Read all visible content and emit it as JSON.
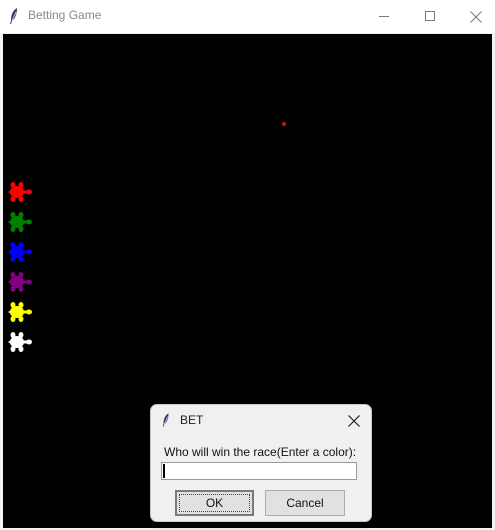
{
  "window": {
    "title": "Betting Game",
    "icon": "feather-icon",
    "controls": [
      "minimize-icon",
      "maximize-icon",
      "close-icon"
    ]
  },
  "canvas": {
    "background": "#000000",
    "turtles": [
      {
        "color": "red"
      },
      {
        "color": "green"
      },
      {
        "color": "blue"
      },
      {
        "color": "purple"
      },
      {
        "color": "yellow"
      },
      {
        "color": "white"
      }
    ]
  },
  "dialog": {
    "title": "BET",
    "icon": "feather-icon",
    "prompt": "Who will win the race(Enter a color):",
    "input_value": "",
    "ok_label": "OK",
    "cancel_label": "Cancel"
  }
}
